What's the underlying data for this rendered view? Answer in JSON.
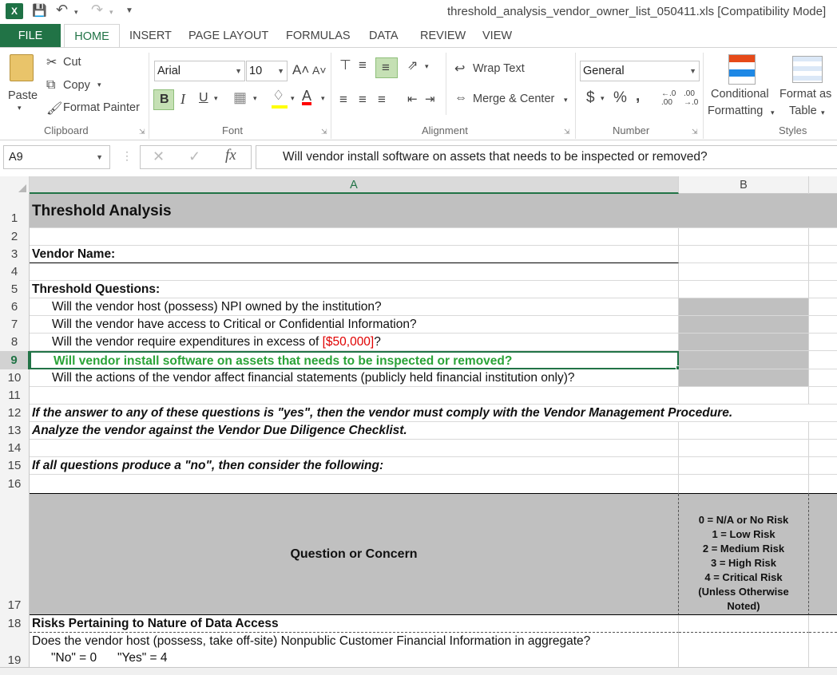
{
  "window": {
    "title": "threshold_analysis_vendor_owner_list_050411.xls  [Compatibility Mode]",
    "app_icon": "excel-icon"
  },
  "ribbon": {
    "tabs": [
      "FILE",
      "HOME",
      "INSERT",
      "PAGE LAYOUT",
      "FORMULAS",
      "DATA",
      "REVIEW",
      "VIEW"
    ],
    "active_tab": "HOME",
    "clipboard": {
      "paste": "Paste",
      "cut": "Cut",
      "copy": "Copy",
      "format_painter": "Format Painter",
      "label": "Clipboard"
    },
    "font": {
      "name": "Arial",
      "size": "10",
      "label": "Font"
    },
    "alignment": {
      "wrap_text": "Wrap Text",
      "merge_center": "Merge & Center",
      "label": "Alignment"
    },
    "number": {
      "format": "General",
      "label": "Number"
    },
    "styles": {
      "conditional": "Conditional",
      "formatting": "Formatting",
      "format_as": "Format as",
      "table": "Table",
      "label": "Styles"
    }
  },
  "formula_bar": {
    "name_box": "A9",
    "formula": "Will vendor install software on assets that needs to be inspected or removed?"
  },
  "columns": [
    "A",
    "B"
  ],
  "rows": {
    "r1": "Threshold Analysis",
    "r3": "Vendor Name:",
    "r5": "Threshold Questions:",
    "r6": "Will the vendor host (possess) NPI owned by the institution?",
    "r7": "Will the vendor have access to Critical or Confidential Information?",
    "r8_pre": "Will the vendor require expenditures in excess of ",
    "r8_amount": "[$50,000]",
    "r8_post": "?",
    "r9": "Will vendor install software on assets that needs to be inspected or removed?",
    "r10": "Will the actions of the vendor affect financial statements (publicly held financial institution only)?",
    "r12": "If the answer to any of these questions is \"yes\", then the vendor must comply with the Vendor Management Procedure.",
    "r13": "Analyze the vendor against the Vendor Due Diligence Checklist.",
    "r15": "If all questions produce a \"no\", then consider the following:",
    "r17_a": "Question or Concern",
    "r17_b": [
      "0 = N/A or No Risk",
      "1 = Low Risk",
      "2 = Medium Risk",
      "3 = High Risk",
      "4 = Critical Risk",
      "(Unless Otherwise",
      "Noted)"
    ],
    "r18": "Risks Pertaining to Nature of Data Access",
    "r19_a": "Does the vendor host (possess, take off-site) Nonpublic Customer Financial Information in aggregate?",
    "r19_b": "\"No\" = 0      \"Yes\" = 4"
  },
  "colors": {
    "excel_green": "#217346",
    "selected_text": "#2aa337",
    "highlight_red": "#e00000",
    "gray_fill": "#c0c0c0"
  }
}
